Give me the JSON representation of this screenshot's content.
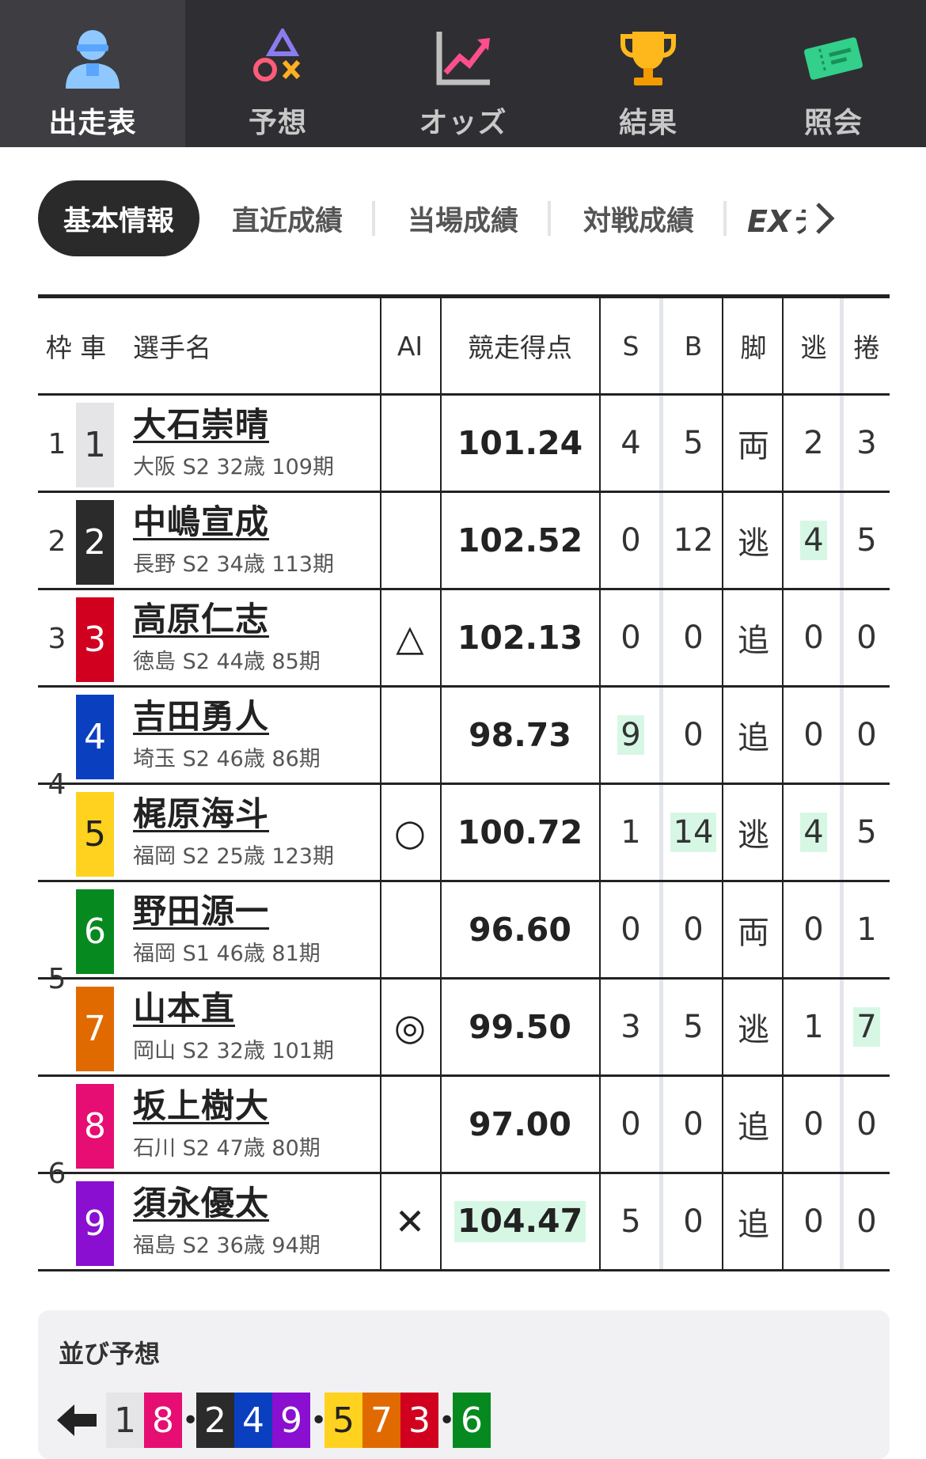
{
  "nav": {
    "items": [
      {
        "label": "出走表",
        "icon": "person-helmet-icon",
        "active": true
      },
      {
        "label": "予想",
        "icon": "shapes-icon",
        "active": false
      },
      {
        "label": "オッズ",
        "icon": "chart-up-icon",
        "active": false
      },
      {
        "label": "結果",
        "icon": "trophy-icon",
        "active": false
      },
      {
        "label": "照会",
        "icon": "ticket-icon",
        "active": false
      }
    ]
  },
  "subtabs": {
    "items": [
      "基本情報",
      "直近成績",
      "当場成績",
      "対戦成績"
    ],
    "ex_label": "EXデ"
  },
  "table": {
    "headers": {
      "waku_kuruma": "枠 車",
      "name": "選手名",
      "ai": "AI",
      "score": "競走得点",
      "s": "S",
      "b": "B",
      "kyaku": "脚",
      "nige": "逃",
      "makuri": "捲"
    },
    "frames": [
      {
        "waku": "1",
        "rows": 1
      },
      {
        "waku": "2",
        "rows": 1
      },
      {
        "waku": "3",
        "rows": 1
      },
      {
        "waku": "4",
        "rows": 2
      },
      {
        "waku": "5",
        "rows": 2
      },
      {
        "waku": "6",
        "rows": 2
      }
    ],
    "rows": [
      {
        "car": "1",
        "name": "大石崇晴",
        "info": "大阪 S2 32歳 109期",
        "ai": "",
        "score": "101.24",
        "s": "4",
        "b": "5",
        "kyaku": "両",
        "nige": "2",
        "makuri": "3",
        "hl": []
      },
      {
        "car": "2",
        "name": "中嶋宣成",
        "info": "長野 S2 34歳 113期",
        "ai": "",
        "score": "102.52",
        "s": "0",
        "b": "12",
        "kyaku": "逃",
        "nige": "4",
        "makuri": "5",
        "hl": [
          "nige"
        ]
      },
      {
        "car": "3",
        "name": "高原仁志",
        "info": "徳島 S2 44歳 85期",
        "ai": "△",
        "score": "102.13",
        "s": "0",
        "b": "0",
        "kyaku": "追",
        "nige": "0",
        "makuri": "0",
        "hl": []
      },
      {
        "car": "4",
        "name": "吉田勇人",
        "info": "埼玉 S2 46歳 86期",
        "ai": "",
        "score": "98.73",
        "s": "9",
        "b": "0",
        "kyaku": "追",
        "nige": "0",
        "makuri": "0",
        "hl": [
          "s"
        ]
      },
      {
        "car": "5",
        "name": "梶原海斗",
        "info": "福岡 S2 25歳 123期",
        "ai": "○",
        "score": "100.72",
        "s": "1",
        "b": "14",
        "kyaku": "逃",
        "nige": "4",
        "makuri": "5",
        "hl": [
          "b",
          "nige"
        ]
      },
      {
        "car": "6",
        "name": "野田源一",
        "info": "福岡 S1 46歳 81期",
        "ai": "",
        "score": "96.60",
        "s": "0",
        "b": "0",
        "kyaku": "両",
        "nige": "0",
        "makuri": "1",
        "hl": []
      },
      {
        "car": "7",
        "name": "山本直",
        "info": "岡山 S2 32歳 101期",
        "ai": "◎",
        "score": "99.50",
        "s": "3",
        "b": "5",
        "kyaku": "逃",
        "nige": "1",
        "makuri": "7",
        "hl": [
          "makuri"
        ]
      },
      {
        "car": "8",
        "name": "坂上樹大",
        "info": "石川 S2 47歳 80期",
        "ai": "",
        "score": "97.00",
        "s": "0",
        "b": "0",
        "kyaku": "追",
        "nige": "0",
        "makuri": "0",
        "hl": []
      },
      {
        "car": "9",
        "name": "須永優太",
        "info": "福島 S2 36歳 94期",
        "ai": "✕",
        "score": "104.47",
        "s": "5",
        "b": "0",
        "kyaku": "追",
        "nige": "0",
        "makuri": "0",
        "hl": [
          "score"
        ]
      }
    ]
  },
  "narabi": {
    "title": "並び予想",
    "groups": [
      [
        "1",
        "8"
      ],
      [
        "2",
        "4",
        "9"
      ],
      [
        "5",
        "7",
        "3"
      ],
      [
        "6"
      ]
    ]
  },
  "colors": {
    "car_bg": {
      "1": "#e5e5e8",
      "2": "#2b2b2b",
      "3": "#d1001f",
      "4": "#0a3fc0",
      "5": "#ffd21f",
      "6": "#068a1f",
      "7": "#e06a00",
      "8": "#e60e72",
      "9": "#8a0fd0"
    },
    "car_fg": {
      "1": "#333333",
      "2": "#ffffff",
      "3": "#ffffff",
      "4": "#ffffff",
      "5": "#222222",
      "6": "#ffffff",
      "7": "#ffffff",
      "8": "#ffffff",
      "9": "#ffffff"
    },
    "highlight": "#d7f7e5",
    "nav_bg": "#2f2f33"
  }
}
